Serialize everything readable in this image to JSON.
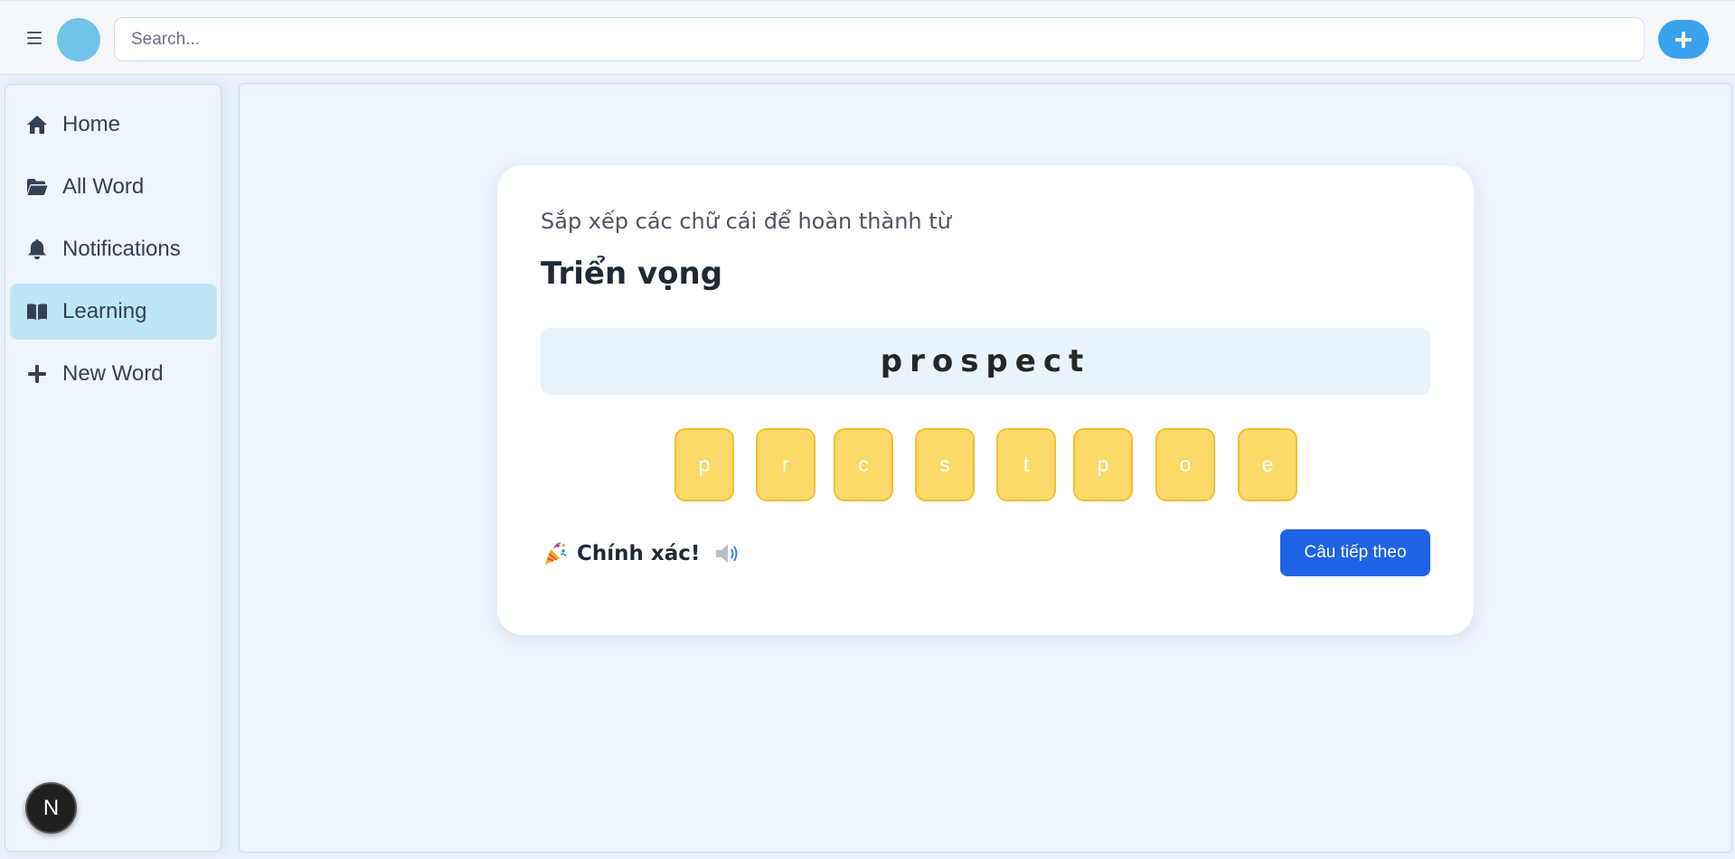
{
  "header": {
    "search_placeholder": "Search...",
    "accent_color": "#3aa1ec"
  },
  "sidebar": {
    "items": [
      {
        "label": "Home",
        "icon": "home-icon"
      },
      {
        "label": "All Word",
        "icon": "folder-open-icon"
      },
      {
        "label": "Notifications",
        "icon": "bell-icon"
      },
      {
        "label": "Learning",
        "icon": "book-open-icon",
        "active": true
      },
      {
        "label": "New Word",
        "icon": "plus-icon"
      }
    ],
    "badge": "N"
  },
  "exercise": {
    "instruction": "Sắp xếp các chữ cái để hoàn thành từ",
    "meaning": "Triển vọng",
    "answer": "prospect",
    "tiles": [
      "p",
      "r",
      "c",
      "s",
      "t",
      "p",
      "o",
      "e"
    ],
    "result_text": "Chính xác!",
    "result_icon": "party-popper-icon",
    "sound_icon": "speaker-icon",
    "next_label": "Câu tiếp theo",
    "tile_color": "#fdd96a",
    "button_color": "#1f63e6"
  }
}
